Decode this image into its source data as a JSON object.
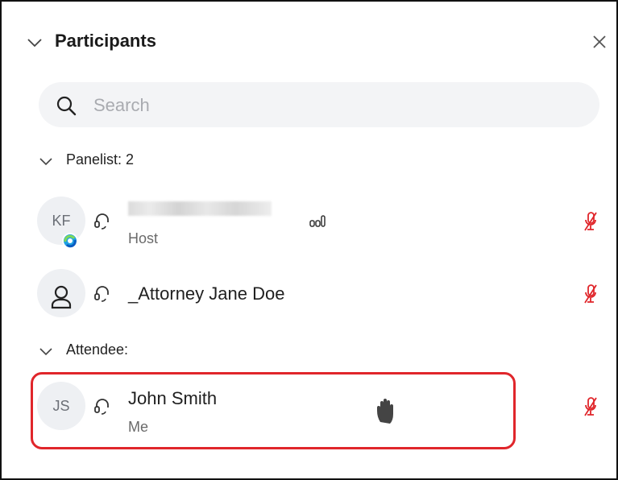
{
  "panel": {
    "title": "Participants",
    "close_icon": "close-icon",
    "collapse_icon": "chevron-down-icon"
  },
  "search": {
    "placeholder": "Search",
    "value": "",
    "icon": "search-icon"
  },
  "sections": {
    "panelists": {
      "label": "Panelist: 2",
      "participants": [
        {
          "initials": "KF",
          "name": "",
          "name_redacted": true,
          "role": "Host",
          "audio_icon": "headset-icon",
          "signal_icon": "audio-level-icon",
          "mic_icon": "mic-muted-icon",
          "status_icon": "webex-status-icon"
        },
        {
          "avatar_icon": "user-icon",
          "name": "_Attorney Jane Doe",
          "audio_icon": "headset-icon",
          "mic_icon": "mic-muted-icon"
        }
      ]
    },
    "attendees": {
      "label": "Attendee:",
      "participants": [
        {
          "initials": "JS",
          "name": "John Smith",
          "role": "Me",
          "audio_icon": "headset-icon",
          "hand_icon": "raised-hand-icon",
          "mic_icon": "mic-muted-icon",
          "highlighted": true
        }
      ]
    }
  },
  "colors": {
    "muted_mic": "#e0262b",
    "highlight_border": "#e0262b",
    "search_bg": "#f3f4f6",
    "avatar_bg": "#eef0f3"
  }
}
